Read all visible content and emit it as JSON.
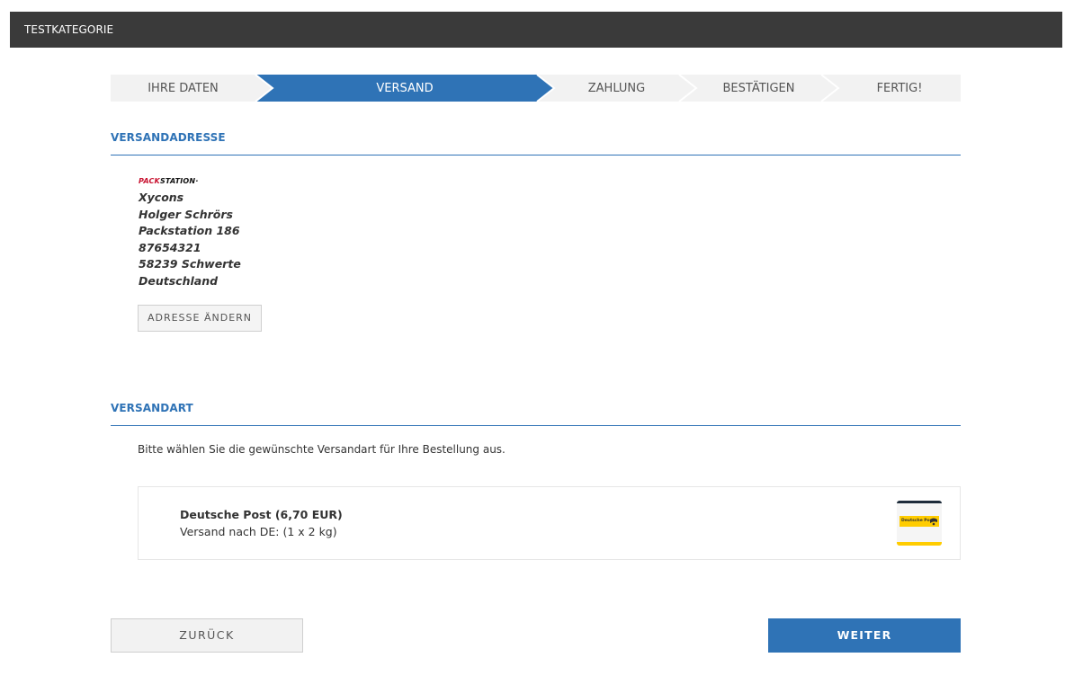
{
  "header": {
    "category": "TESTKATEGORIE"
  },
  "steps": [
    {
      "label": "IHRE DATEN",
      "active": false
    },
    {
      "label": "VERSAND",
      "active": true
    },
    {
      "label": "ZAHLUNG",
      "active": false
    },
    {
      "label": "BESTÄTIGEN",
      "active": false
    },
    {
      "label": "FERTIG!",
      "active": false
    }
  ],
  "shipping_address": {
    "title": "VERSANDADRESSE",
    "logo": {
      "text_red": "PACK",
      "text_black": "STATION",
      "mark": "·"
    },
    "lines": [
      "Xycons",
      "Holger Schrörs",
      "Packstation 186",
      "87654321",
      "58239 Schwerte",
      "Deutschland"
    ],
    "change_button": "ADRESSE ÄNDERN"
  },
  "shipping_method": {
    "title": "VERSANDART",
    "intro": "Bitte wählen Sie die gewünschte Versandart für Ihre Bestellung aus.",
    "option": {
      "name": "Deutsche Post (6,70 EUR)",
      "description": "Versand nach DE: (1 x 2 kg)",
      "logo_text": "Deutsche Post"
    }
  },
  "footer": {
    "back_label": "ZURÜCK",
    "next_label": "WEITER"
  },
  "colors": {
    "accent": "#2f73b6",
    "topbar": "#3a3a3a",
    "step_inactive": "#f2f2f2",
    "packstation_red": "#c8102e",
    "post_yellow": "#ffcc00"
  },
  "icons": {
    "carrier_logo": "deutsche-post-logo-icon",
    "address_logo": "packstation-logo-icon"
  }
}
